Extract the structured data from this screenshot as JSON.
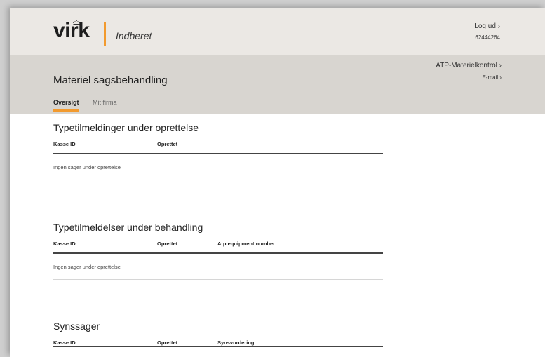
{
  "header": {
    "logo": "virk",
    "subtitle": "Indberet",
    "logout_label": "Log ud ›",
    "cvr_number": "62444264"
  },
  "subheader": {
    "page_title": "Materiel sagsbehandling",
    "service_link": "ATP-Materielkontrol ›",
    "email_link": "E-mail ›"
  },
  "tabs": [
    {
      "label": "Oversigt",
      "active": true
    },
    {
      "label": "Mit firma",
      "active": false
    }
  ],
  "sections": [
    {
      "title": "Typetilmeldinger under oprettelse",
      "columns": [
        "Kasse ID",
        "Oprettet"
      ],
      "empty_text": "Ingen sager under oprettelse"
    },
    {
      "title": "Typetilmeldelser under behandling",
      "columns": [
        "Kasse ID",
        "Oprettet",
        "Atp equipment number"
      ],
      "empty_text": "Ingen sager under oprettelse"
    },
    {
      "title": "Synssager",
      "columns": [
        "Kasse ID",
        "Oprettet",
        "Synsvurdering"
      ]
    }
  ],
  "colors": {
    "accent": "#f29a2e",
    "topbar_bg": "#ebe8e4",
    "subbar_bg": "#d8d5d0"
  }
}
